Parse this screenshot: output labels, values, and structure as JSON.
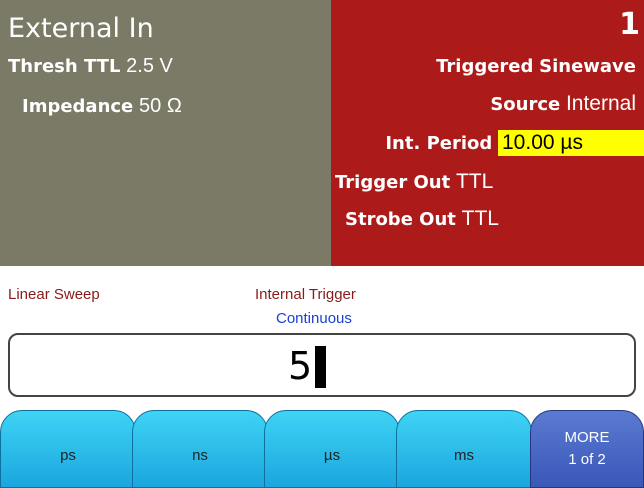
{
  "external": {
    "title": "External In",
    "thresh_label": "Thresh TTL",
    "thresh_value": "2.5 V",
    "impedance_label": "Impedance",
    "impedance_value": "50 Ω"
  },
  "channel": {
    "number": "1",
    "mode": "Triggered",
    "waveform": "Sinewave",
    "source_label": "Source",
    "source_value": "Internal",
    "period_label": "Int. Period",
    "period_value": "10.00 µs",
    "trigger_out_label": "Trigger Out",
    "trigger_out_value": "TTL",
    "strobe_out_label": "Strobe Out",
    "strobe_out_value": "TTL"
  },
  "status": {
    "sweep": "Linear Sweep",
    "trigger": "Internal Trigger",
    "trigger_mode": "Continuous"
  },
  "entry": {
    "value": "5"
  },
  "softkeys": [
    {
      "label": "ps"
    },
    {
      "label": "ns"
    },
    {
      "label": "µs"
    },
    {
      "label": "ms"
    }
  ],
  "more_key": {
    "line1": "MORE",
    "line2": "1 of 2"
  },
  "colors": {
    "external_bg": "#7a7a66",
    "channel_bg": "#ad1a1a",
    "highlight": "#ffff00",
    "softkey": "#2cbbe8",
    "more_key": "#4a68c6"
  }
}
